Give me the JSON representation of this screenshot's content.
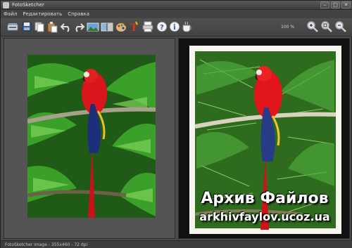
{
  "window": {
    "title": "FotoSketcher"
  },
  "menu": {
    "items": [
      "Файл",
      "Редактировать",
      "Справка"
    ]
  },
  "toolbar": {
    "zoom_label": "100 %",
    "icons": [
      "scanner-icon",
      "save-icon",
      "copy-icon",
      "paste-icon",
      "undo-icon",
      "redo-icon",
      "landscape-icon",
      "compare-icon",
      "palette-icon",
      "text-tool-icon",
      "print-icon",
      "help-icon",
      "info-icon",
      "coffee-icon",
      "zoom-in-icon",
      "zoom-fit-icon",
      "zoom-out-icon"
    ]
  },
  "watermark": {
    "title": "Архив Файлов",
    "url": "arkhivfaylov.ucoz.ua"
  },
  "status": {
    "text": "FotoSketcher image - 355x460 - 72 dpi"
  },
  "colors": {
    "window_bg": "#4a4a4a",
    "panel_bg": "#545454",
    "parrot_red": "#d8161b",
    "foliage_green": "#2f8a1f"
  }
}
